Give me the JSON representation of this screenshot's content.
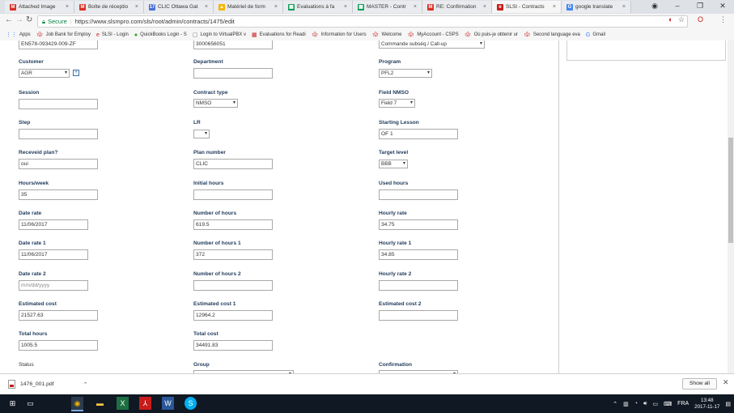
{
  "browser": {
    "tabs": [
      {
        "label": "Attached Image",
        "fav": "M",
        "color": "#d93025"
      },
      {
        "label": "Boîte de réceptio",
        "fav": "M",
        "color": "#d93025"
      },
      {
        "label": "CLIC Ottawa Gat",
        "fav": "17",
        "color": "#4a6fd6"
      },
      {
        "label": "Matériel de form",
        "fav": "▲",
        "color": "#f4b400"
      },
      {
        "label": "Evaluations à fa",
        "fav": "▦",
        "color": "#0f9d58"
      },
      {
        "label": "MASTER - Contr",
        "fav": "▦",
        "color": "#0f9d58"
      },
      {
        "label": "RE: Confirmation",
        "fav": "M",
        "color": "#d93025"
      },
      {
        "label": "SLSI - Contracts",
        "fav": "e",
        "color": "#c81c1c"
      },
      {
        "label": "google translate",
        "fav": "G",
        "color": "#4285f4"
      }
    ],
    "secure_label": "Secure",
    "url": "https://www.slsmpro.com/sls/root/admin/contracts/1475/edit",
    "bookmarks": [
      "Apps",
      "Job Bank for Employ",
      "SLSI - Login",
      "QuickBooks Login - S",
      "Login to VirtualPBX v",
      "Evaluations for Readi",
      "Information for Users",
      "Welcome",
      "MyAccount - CSPS",
      "Où puis-je obtenir ur",
      "Second language eva",
      "Gmail"
    ]
  },
  "form": {
    "top_row": {
      "field1": "EN578-093429-009-ZF",
      "field2": "3000656051",
      "field3": "Commande subséq./ Call-up"
    },
    "customer": {
      "label": "Customer",
      "value": "AGR"
    },
    "department": {
      "label": "Department",
      "value": ""
    },
    "program": {
      "label": "Program",
      "value": "PFL2"
    },
    "session": {
      "label": "Session",
      "value": ""
    },
    "contract_type": {
      "label": "Contract type",
      "value": "NMSO"
    },
    "field_nmso": {
      "label": "Field NMSO",
      "value": "Field 7"
    },
    "step": {
      "label": "Step",
      "value": ""
    },
    "lr": {
      "label": "LR",
      "value": ""
    },
    "starting_lesson": {
      "label": "Starting Lesson",
      "value": "OF 1"
    },
    "received_plan": {
      "label": "Receveid plan?",
      "value": "oui"
    },
    "plan_number": {
      "label": "Plan number",
      "value": "CLIC"
    },
    "target_level": {
      "label": "Target level",
      "value": "BBB"
    },
    "hours_week": {
      "label": "Hours/week",
      "value": "35"
    },
    "initial_hours": {
      "label": "Initial hours",
      "value": ""
    },
    "used_hours": {
      "label": "Used hours",
      "value": ""
    },
    "date_rate": {
      "label": "Date rate",
      "value": "11/06/2017"
    },
    "number_of_hours": {
      "label": "Number of hours",
      "value": "619.5"
    },
    "hourly_rate": {
      "label": "Hourly rate",
      "value": "34.75"
    },
    "date_rate_1": {
      "label": "Date rate 1",
      "value": "11/06/2017"
    },
    "number_of_hours_1": {
      "label": "Number of hours 1",
      "value": "372"
    },
    "hourly_rate_1": {
      "label": "Hourly rate 1",
      "value": "34.85"
    },
    "date_rate_2": {
      "label": "Date rate 2",
      "placeholder": "mm/dd/yyyy"
    },
    "number_of_hours_2": {
      "label": "Number of hours 2",
      "value": ""
    },
    "hourly_rate_2": {
      "label": "Hourly rate 2",
      "value": ""
    },
    "estimated_cost": {
      "label": "Estimated cost",
      "value": "21527.63"
    },
    "estimated_cost_1": {
      "label": "Estimated cost 1",
      "value": "12964.2"
    },
    "estimated_cost_2": {
      "label": "Estimated cost 2",
      "value": ""
    },
    "total_hours": {
      "label": "Total hours",
      "value": "1005.5"
    },
    "total_cost": {
      "label": "Total cost",
      "value": "34491.83"
    },
    "status": {
      "label": "Status"
    },
    "group": {
      "label": "Group"
    },
    "confirmation": {
      "label": "Confirmation"
    }
  },
  "downloads": {
    "file": "1476_001.pdf",
    "show_all": "Show all"
  },
  "taskbar": {
    "lang": "FRA",
    "time": "13:48",
    "date": "2017-11-17"
  }
}
